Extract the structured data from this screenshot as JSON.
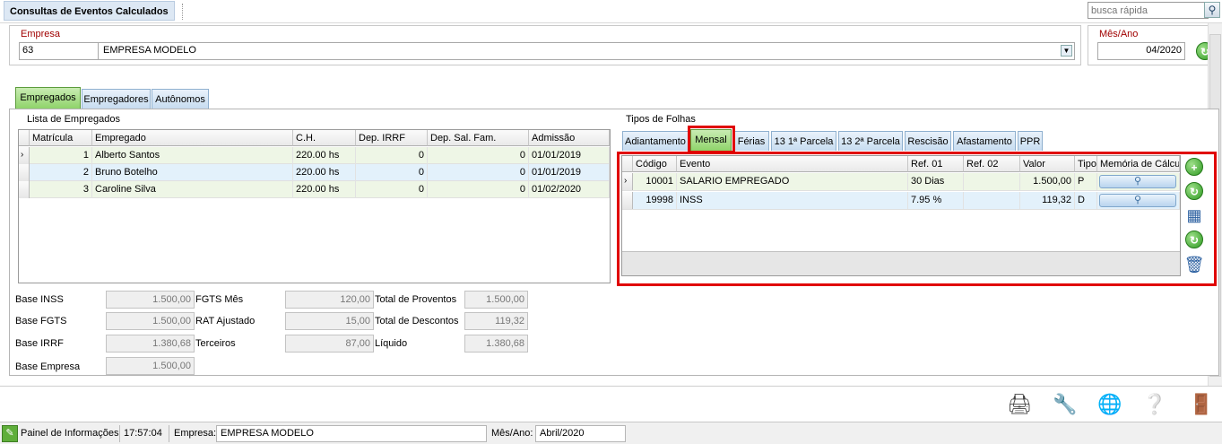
{
  "window": {
    "title": "Consultas de Eventos Calculados"
  },
  "search": {
    "placeholder": "busca rápida",
    "icon": "magnifier-icon"
  },
  "empresa": {
    "label": "Empresa",
    "code": "63",
    "name": "EMPRESA MODELO"
  },
  "mesano": {
    "label": "Mês/Ano",
    "value": "04/2020"
  },
  "tabs": [
    "Empregados",
    "Empregadores",
    "Autônomos"
  ],
  "active_tab": "Empregados",
  "employees": {
    "title": "Lista de Empregados",
    "columns": [
      "Matrícula",
      "Empregado",
      "C.H.",
      "Dep. IRRF",
      "Dep. Sal. Fam.",
      "Admissão"
    ],
    "rows": [
      {
        "matricula": "1",
        "nome": "Alberto Santos",
        "ch": "220.00 hs",
        "dep_irrf": "0",
        "dep_sal": "0",
        "admissao": "01/01/2019"
      },
      {
        "matricula": "2",
        "nome": "Bruno Botelho",
        "ch": "220.00 hs",
        "dep_irrf": "0",
        "dep_sal": "0",
        "admissao": "01/01/2019"
      },
      {
        "matricula": "3",
        "nome": "Caroline Silva",
        "ch": "220.00 hs",
        "dep_irrf": "0",
        "dep_sal": "0",
        "admissao": "01/02/2020"
      }
    ]
  },
  "folhas": {
    "title": "Tipos de Folhas",
    "tabs": [
      "Adiantamento",
      "Mensal",
      "Férias",
      "13 1ª Parcela",
      "13 2ª Parcela",
      "Rescisão",
      "Afastamento",
      "PPR"
    ],
    "active": "Mensal",
    "columns": [
      "Código",
      "Evento",
      "Ref. 01",
      "Ref. 02",
      "Valor",
      "Tipo",
      "Memória de Cálculo"
    ],
    "rows": [
      {
        "codigo": "10001",
        "evento": "SALARIO EMPREGADO",
        "ref1": "30 Dias",
        "ref2": "",
        "valor": "1.500,00",
        "tipo": "P"
      },
      {
        "codigo": "19998",
        "evento": "INSS",
        "ref1": "7.95 %",
        "ref2": "",
        "valor": "119,32",
        "tipo": "D"
      }
    ]
  },
  "totals": {
    "base_inss": {
      "label": "Base INSS",
      "value": "1.500,00"
    },
    "base_fgts": {
      "label": "Base FGTS",
      "value": "1.500,00"
    },
    "base_irrf": {
      "label": "Base IRRF",
      "value": "1.380,68"
    },
    "base_empresa": {
      "label": "Base Empresa",
      "value": "1.500,00"
    },
    "fgts_mes": {
      "label": "FGTS Mês",
      "value": "120,00"
    },
    "rat": {
      "label": "RAT Ajustado",
      "value": "15,00"
    },
    "terceiros": {
      "label": "Terceiros",
      "value": "87,00"
    },
    "proventos": {
      "label": "Total de Proventos",
      "value": "1.500,00"
    },
    "descontos": {
      "label": "Total de Descontos",
      "value": "119,32"
    },
    "liquido": {
      "label": "Líquido",
      "value": "1.380,68"
    }
  },
  "statusbar": {
    "panel_label": "Painel de Informações",
    "time": "17:57:04",
    "empresa_label": "Empresa:",
    "empresa_value": "EMPRESA MODELO",
    "mes_label": "Mês/Ano:",
    "mes_value": "Abril/2020"
  },
  "colors": {
    "highlight": "#e00000",
    "active_tab": "#8fd36a",
    "tab": "#c7dcf0"
  }
}
